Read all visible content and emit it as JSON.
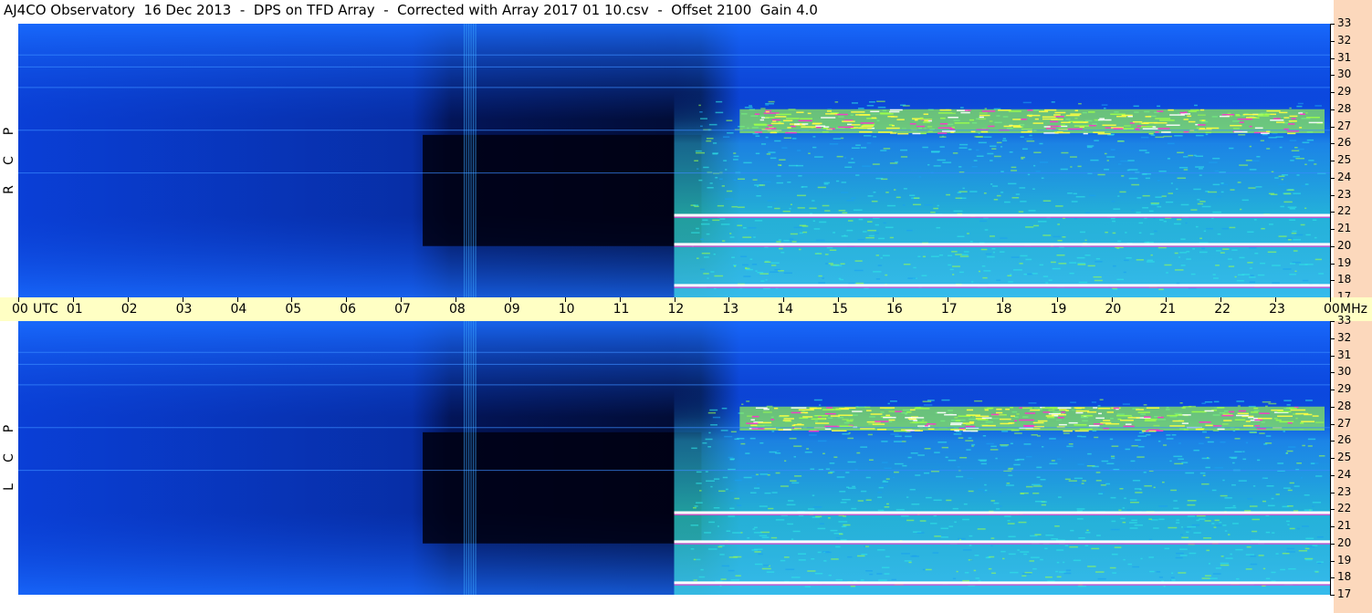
{
  "title": "AJ4CO Observatory  16 Dec 2013  -  DPS on TFD Array  -  Corrected with Array 2017 01 10.csv  -  Offset 2100  Gain 4.0",
  "colors": {
    "background_low": "#000010",
    "background_mid": "#0033cc",
    "background_high": "#0080ff",
    "cyan": "#2fe6e6",
    "green": "#9cff4a",
    "yellow": "#ffff40",
    "magenta": "#ff33cc",
    "white": "#ffffff",
    "utc_bar": "#ffffc4",
    "side_band": "#fcd8bc"
  },
  "chart_data": [
    {
      "type": "heatmap",
      "panel": "top",
      "polarization_label": [
        "R",
        "C",
        "P"
      ],
      "xlabel": "UTC",
      "ylabel": "MHz",
      "x_ticks": [
        "00",
        "01",
        "02",
        "03",
        "04",
        "05",
        "06",
        "07",
        "08",
        "09",
        "10",
        "11",
        "12",
        "13",
        "14",
        "15",
        "16",
        "17",
        "18",
        "19",
        "20",
        "21",
        "22",
        "23",
        "00"
      ],
      "y_ticks": [
        "17",
        "18",
        "19",
        "20",
        "21",
        "22",
        "23",
        "24",
        "25",
        "26",
        "27",
        "28",
        "29",
        "30",
        "31",
        "32",
        "33"
      ],
      "xlim": [
        0,
        24
      ],
      "ylim": [
        17,
        33
      ],
      "features": {
        "quiet_period_utc": [
          0,
          12
        ],
        "active_period_utc": [
          12,
          24
        ],
        "burst_column_utc": 8.25,
        "strong_band_mhz": [
          26.6,
          28.0
        ],
        "bright_lines_mhz": [
          17.7,
          21.8,
          20.1
        ]
      }
    },
    {
      "type": "heatmap",
      "panel": "bottom",
      "polarization_label": [
        "L",
        "C",
        "P"
      ],
      "xlabel": "UTC",
      "ylabel": "MHz",
      "x_ticks": [
        "00",
        "01",
        "02",
        "03",
        "04",
        "05",
        "06",
        "07",
        "08",
        "09",
        "10",
        "11",
        "12",
        "13",
        "14",
        "15",
        "16",
        "17",
        "18",
        "19",
        "20",
        "21",
        "22",
        "23",
        "00"
      ],
      "y_ticks": [
        "17",
        "18",
        "19",
        "20",
        "21",
        "22",
        "23",
        "24",
        "25",
        "26",
        "27",
        "28",
        "29",
        "30",
        "31",
        "32",
        "33"
      ],
      "xlim": [
        0,
        24
      ],
      "ylim": [
        17,
        33
      ],
      "features": {
        "quiet_period_utc": [
          0,
          12
        ],
        "active_period_utc": [
          12,
          24
        ],
        "burst_column_utc": 8.25,
        "strong_band_mhz": [
          26.6,
          28.0
        ],
        "bright_lines_mhz": [
          17.7,
          21.8,
          20.1
        ]
      }
    }
  ],
  "utc_bar": {
    "first_label": "00",
    "unit_label": "UTC",
    "last_label": "00",
    "freq_unit": "MHz"
  }
}
